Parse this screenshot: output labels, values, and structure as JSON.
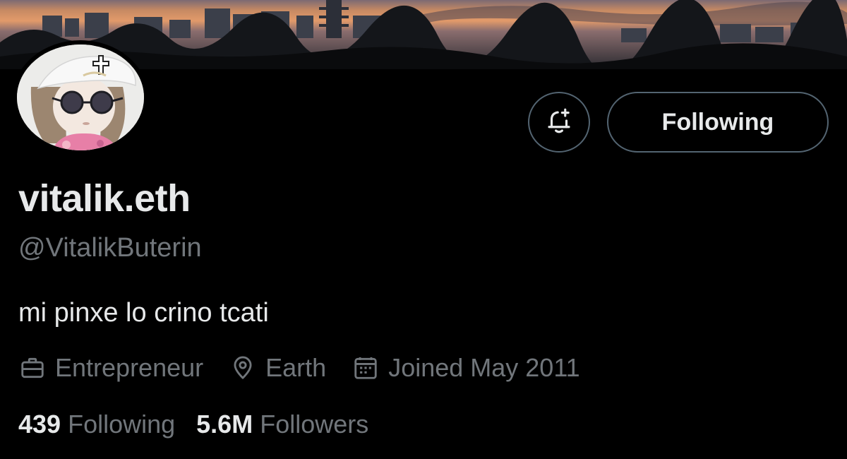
{
  "profile": {
    "display_name": "vitalik.eth",
    "handle": "@VitalikButerin",
    "bio": "mi pinxe lo crino tcati"
  },
  "actions": {
    "notify_icon": "bell-plus-icon",
    "follow_label": "Following"
  },
  "meta": {
    "profession": {
      "icon": "briefcase-icon",
      "label": "Entrepreneur"
    },
    "location": {
      "icon": "location-pin-icon",
      "label": "Earth"
    },
    "joined": {
      "icon": "calendar-icon",
      "label": "Joined May 2011"
    }
  },
  "stats": {
    "following_count": "439",
    "following_label": "Following",
    "followers_count": "5.6M",
    "followers_label": "Followers"
  },
  "colors": {
    "background": "#000000",
    "primary_text": "#e7e9ea",
    "secondary_text": "#71767b",
    "button_border": "#536471"
  }
}
